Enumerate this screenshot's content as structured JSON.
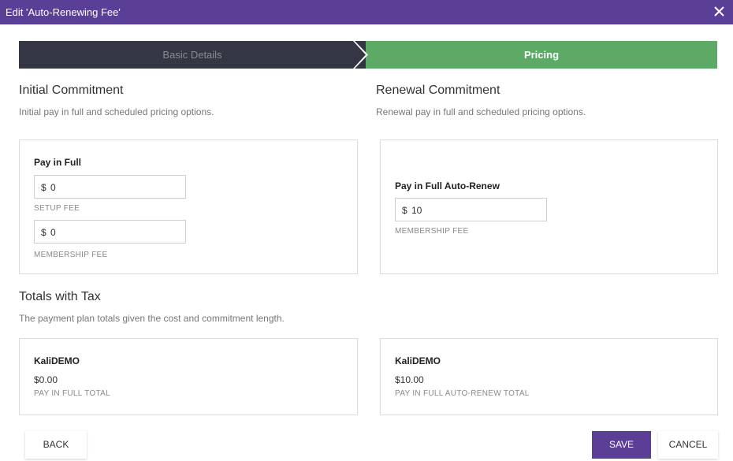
{
  "dialog": {
    "title": "Edit 'Auto-Renewing Fee'"
  },
  "steps": [
    {
      "label": "Basic Details"
    },
    {
      "label": "Pricing"
    }
  ],
  "initial": {
    "title": "Initial Commitment",
    "subtitle": "Initial pay in full and scheduled pricing options.",
    "card_heading": "Pay in Full",
    "setup_fee": {
      "currency": "$",
      "value": "0",
      "label": "SETUP FEE"
    },
    "membership_fee": {
      "currency": "$",
      "value": "0",
      "label": "MEMBERSHIP FEE"
    }
  },
  "renewal": {
    "title": "Renewal Commitment",
    "subtitle": "Renewal pay in full and scheduled pricing options.",
    "card_heading": "Pay in Full Auto-Renew",
    "membership_fee": {
      "currency": "$",
      "value": "10",
      "label": "MEMBERSHIP FEE"
    }
  },
  "totals": {
    "title": "Totals with Tax",
    "subtitle": "The payment plan totals given the cost and commitment length.",
    "cards": [
      {
        "name": "KaliDEMO",
        "amount": "$0.00",
        "label": "PAY IN FULL TOTAL"
      },
      {
        "name": "KaliDEMO",
        "amount": "$10.00",
        "label": "PAY IN FULL AUTO-RENEW TOTAL"
      }
    ]
  },
  "buttons": {
    "back": "BACK",
    "save": "SAVE",
    "cancel": "CANCEL"
  },
  "colors": {
    "header": "#5b3f97",
    "step_inactive": "#343743",
    "step_active": "#5daa67",
    "save": "#5b3f97"
  }
}
